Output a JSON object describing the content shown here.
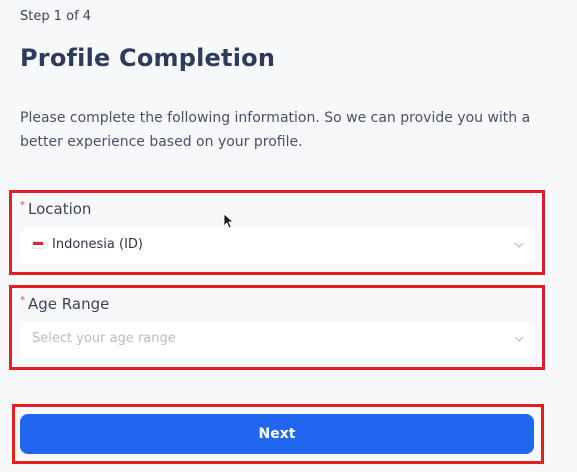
{
  "header": {
    "step": "Step 1 of 4",
    "title": "Profile Completion",
    "description": "Please complete the following information. So we can provide you with a better experience based on your profile."
  },
  "form": {
    "required_marker": "*",
    "location": {
      "label": "Location",
      "selected_value": "Indonesia  (ID)",
      "flag_icon": "indonesia-flag-icon"
    },
    "age_range": {
      "label": "Age Range",
      "placeholder": "Select your age range",
      "value": ""
    },
    "next_label": "Next"
  },
  "colors": {
    "primary_button": "#2266f0",
    "highlight_outline": "#e01e24",
    "required_marker": "#e64b55",
    "title_text": "#2e3b5b",
    "background": "#f7f8fa"
  },
  "icons": [
    "chevron-down-icon",
    "indonesia-flag-icon",
    "mouse-cursor-icon"
  ]
}
